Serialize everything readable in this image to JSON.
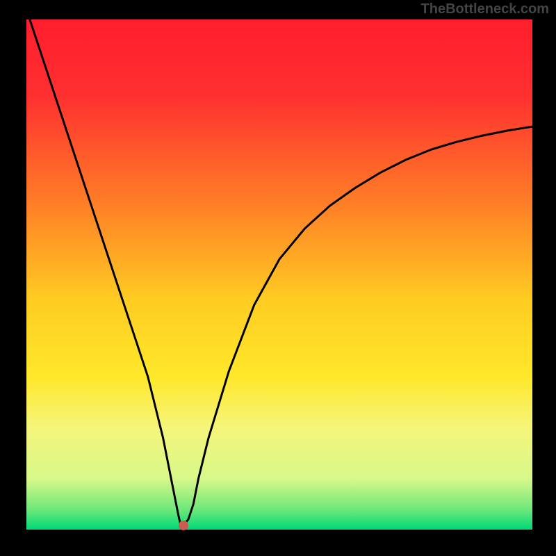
{
  "watermark": "TheBottleneck.com",
  "chart_data": {
    "type": "line",
    "title": "",
    "xlabel": "",
    "ylabel": "",
    "xlim": [
      0,
      100
    ],
    "ylim": [
      0,
      100
    ],
    "gradient_stops": [
      {
        "offset": 0,
        "color": "#ff1e2d"
      },
      {
        "offset": 15,
        "color": "#ff3030"
      },
      {
        "offset": 35,
        "color": "#ff7a27"
      },
      {
        "offset": 55,
        "color": "#ffcc22"
      },
      {
        "offset": 70,
        "color": "#ffe82a"
      },
      {
        "offset": 80,
        "color": "#f5f57a"
      },
      {
        "offset": 90,
        "color": "#d8f88a"
      },
      {
        "offset": 96,
        "color": "#6fe87a"
      },
      {
        "offset": 100,
        "color": "#00d977"
      }
    ],
    "series": [
      {
        "name": "bottleneck-curve",
        "color": "#000000",
        "x": [
          0,
          4,
          8,
          12,
          16,
          20,
          24,
          27,
          29,
          30,
          30.5,
          31,
          32,
          33,
          34,
          36,
          40,
          45,
          50,
          55,
          60,
          65,
          70,
          75,
          80,
          85,
          90,
          95,
          100
        ],
        "values": [
          102,
          90,
          78,
          66,
          54,
          42,
          30,
          18,
          8,
          3,
          0.8,
          0.8,
          2,
          5,
          10,
          18,
          31,
          44,
          53,
          59,
          63.5,
          67,
          70,
          72.5,
          74.5,
          76,
          77.2,
          78.2,
          79
        ]
      }
    ],
    "marker": {
      "x": 31,
      "y": 0.8,
      "color": "#c95b50"
    }
  }
}
